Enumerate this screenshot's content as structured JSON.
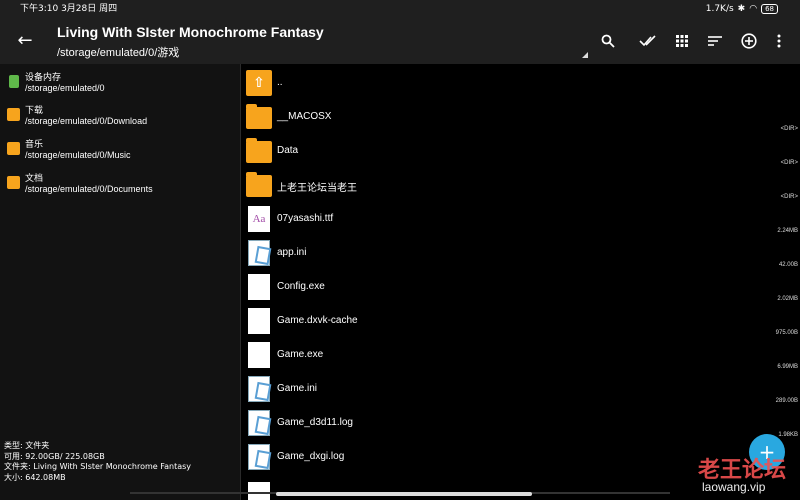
{
  "status_bar": {
    "time_date": "下午3:10  3月28日 周四",
    "net_speed": "1.7K/s",
    "battery": "68"
  },
  "header": {
    "title": "Living With SIster Monochrome Fantasy",
    "path": "/storage/emulated/0/游戏"
  },
  "sidebar": {
    "items": [
      {
        "label": "设备内存",
        "path": "/storage/emulated/0",
        "icon": "phone-storage-icon",
        "color": "#5fb84a"
      },
      {
        "label": "下载",
        "path": "/storage/emulated/0/Download",
        "icon": "download-folder-icon",
        "color": "#f7a41d"
      },
      {
        "label": "音乐",
        "path": "/storage/emulated/0/Music",
        "icon": "music-folder-icon",
        "color": "#f7a41d"
      },
      {
        "label": "文档",
        "path": "/storage/emulated/0/Documents",
        "icon": "document-folder-icon",
        "color": "#f7a41d"
      }
    ]
  },
  "info": {
    "type_row": "类型:   文件夹",
    "avail_row": "可用:   92.00GB/ 225.08GB",
    "folder_row": "文件夹: Living With SIster Monochrome Fantasy",
    "size_row": "大小:   642.08MB"
  },
  "files": [
    {
      "name": "..",
      "size": "",
      "icon": "up-folder"
    },
    {
      "name": "__MACOSX",
      "size": "<DIR>",
      "icon": "folder"
    },
    {
      "name": "Data",
      "size": "<DIR>",
      "icon": "folder"
    },
    {
      "name": "上老王论坛当老王",
      "size": "<DIR>",
      "icon": "folder"
    },
    {
      "name": "07yasashi.ttf",
      "size": "2.24MB",
      "icon": "font"
    },
    {
      "name": "app.ini",
      "size": "42.00B",
      "icon": "ini"
    },
    {
      "name": "Config.exe",
      "size": "2.02MB",
      "icon": "doc"
    },
    {
      "name": "Game.dxvk-cache",
      "size": "975.00B",
      "icon": "doc"
    },
    {
      "name": "Game.exe",
      "size": "6.99MB",
      "icon": "doc"
    },
    {
      "name": "Game.ini",
      "size": "289.00B",
      "icon": "ini"
    },
    {
      "name": "Game_d3d11.log",
      "size": "1.98KB",
      "icon": "ini"
    },
    {
      "name": "Game_dxgi.log",
      "size": "",
      "icon": "ini"
    }
  ],
  "font_icon_text": "Aa",
  "fab_label": "+",
  "watermark": {
    "cn": "老王论坛",
    "en": "laowang.vip"
  }
}
